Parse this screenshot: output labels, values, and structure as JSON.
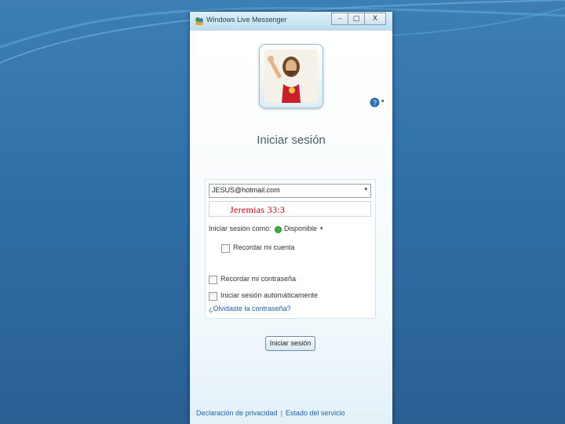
{
  "colors": {
    "desktop_top": "#3c7fb5",
    "desktop_bottom": "#2a5f92",
    "link": "#1e62a8",
    "scripture": "#b8000f",
    "status_online": "#3db03d"
  },
  "window": {
    "title": "Windows Live Messenger",
    "buttons": {
      "minimize": "–",
      "maximize": "□",
      "close": "X"
    }
  },
  "profile": {
    "avatar_icon": "jesus-figure-icon",
    "help_icon": "help-icon",
    "help_caret": "▾"
  },
  "main": {
    "heading": "Iniciar sesión",
    "email_value": "JESUS@hotmail.com",
    "email_caret": "▾",
    "password_overlay": "Jeremias  33:3",
    "signin_as_label": "Iniciar sesión como:",
    "status_value": "Disponible",
    "status_caret": "▾",
    "remember_account": "Recordar mi cuenta",
    "remember_password": "Recordar mi contraseña",
    "auto_signin": "Iniciar sesión automáticamente",
    "forgot_password": "¿Olvidaste la contraseña?",
    "signin_button": "Iniciar sesión"
  },
  "footer": {
    "privacy": "Declaración de privacidad",
    "separator": "|",
    "service_status": "Estado del servicio"
  }
}
